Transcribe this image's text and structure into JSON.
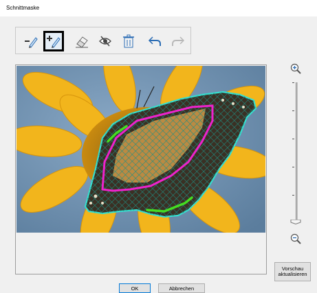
{
  "window": {
    "title": "Schnittmaske"
  },
  "toolbar": {
    "tools": [
      {
        "icon": "pen-icon",
        "state": "normal"
      },
      {
        "icon": "add-pen-icon",
        "state": "active"
      },
      {
        "icon": "eraser-icon",
        "state": "normal"
      },
      {
        "icon": "eye-slash-icon",
        "state": "normal"
      },
      {
        "icon": "trash-icon",
        "state": "normal"
      },
      {
        "icon": "undo-icon",
        "state": "normal"
      },
      {
        "icon": "redo-icon",
        "state": "disabled"
      }
    ]
  },
  "zoom": {
    "in_icon": "zoom-in-icon",
    "out_icon": "zoom-out-icon",
    "level": 0.0
  },
  "buttons": {
    "preview_line1": "Vorschau",
    "preview_line2": "aktualisieren",
    "ok": "OK",
    "cancel": "Abbrechen"
  },
  "colors": {
    "mask_outline": "#35e0d0",
    "mask_hatch": "#1a7a70",
    "mark_keep": "#44dd22",
    "mark_remove": "#ee22cc"
  }
}
